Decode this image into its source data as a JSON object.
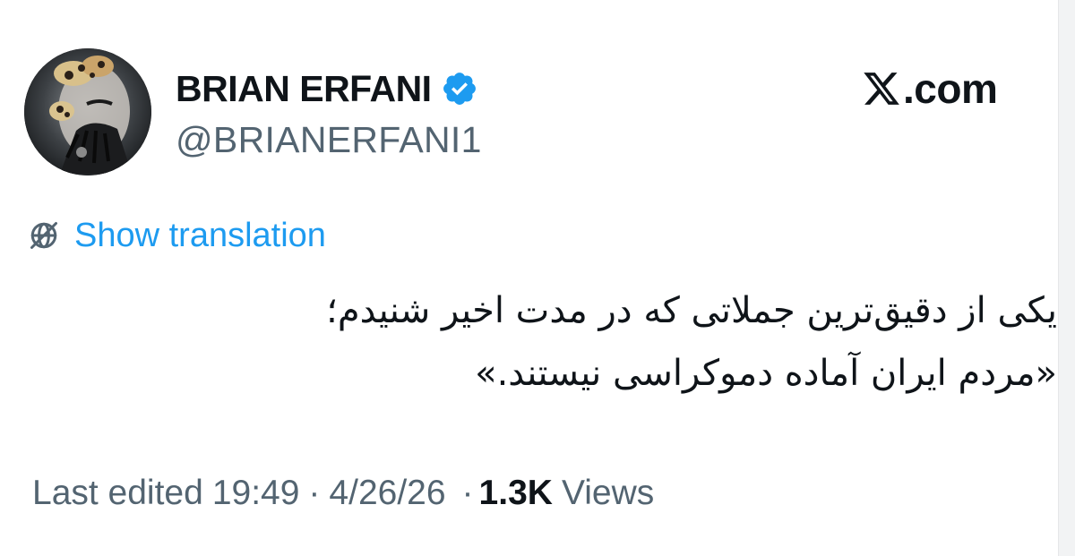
{
  "author": {
    "display_name": "BRIAN ERFANI",
    "handle": "@BRIANERFANI1",
    "verified": true
  },
  "brand": {
    "text": ".com"
  },
  "translation": {
    "label": "Show translation"
  },
  "tweet": {
    "lines": [
      "یکی از دقیق‌ترین جملاتی که در مدت اخیر شنیدم؛",
      "«مردم ایران آماده دموکراسی نیستند.»"
    ]
  },
  "meta": {
    "edited_label": "Last edited",
    "time": "19:49",
    "separator": "·",
    "date": "4/26/26",
    "views_count": "1.3K",
    "views_label": "Views"
  },
  "icons": {
    "verified": "verified-badge-icon",
    "translate": "globe-slash-icon",
    "brand": "x-logo-icon"
  },
  "colors": {
    "link": "#1d9bf0",
    "verified": "#1d9bf0",
    "secondary_text": "#536471",
    "primary_text": "#0f1419"
  }
}
